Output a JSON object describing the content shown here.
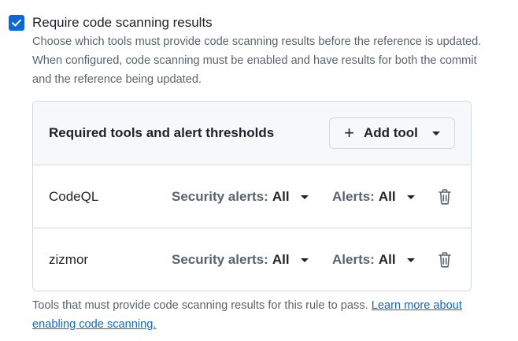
{
  "checkbox": {
    "checked": true,
    "label": "Require code scanning results"
  },
  "description": "Choose which tools must provide code scanning results before the reference is updated. When configured, code scanning must be enabled and have results for both the commit and the reference being updated.",
  "panel": {
    "title": "Required tools and alert thresholds",
    "add_tool_label": "Add tool",
    "add_tool_icon": "plus-icon",
    "tools": [
      {
        "name": "CodeQL",
        "security_alerts_label": "Security alerts:",
        "security_alerts_value": "All",
        "alerts_label": "Alerts:",
        "alerts_value": "All",
        "delete_icon": "trash-icon"
      },
      {
        "name": "zizmor",
        "security_alerts_label": "Security alerts:",
        "security_alerts_value": "All",
        "alerts_label": "Alerts:",
        "alerts_value": "All",
        "delete_icon": "trash-icon"
      }
    ]
  },
  "footer": {
    "text": "Tools that must provide code scanning results for this rule to pass. ",
    "link_text": "Learn more about enabling code scanning."
  },
  "colors": {
    "accent": "#0969da",
    "muted_text": "#59636e",
    "border": "#d1d9e0",
    "header_bg": "#f6f8fa"
  }
}
